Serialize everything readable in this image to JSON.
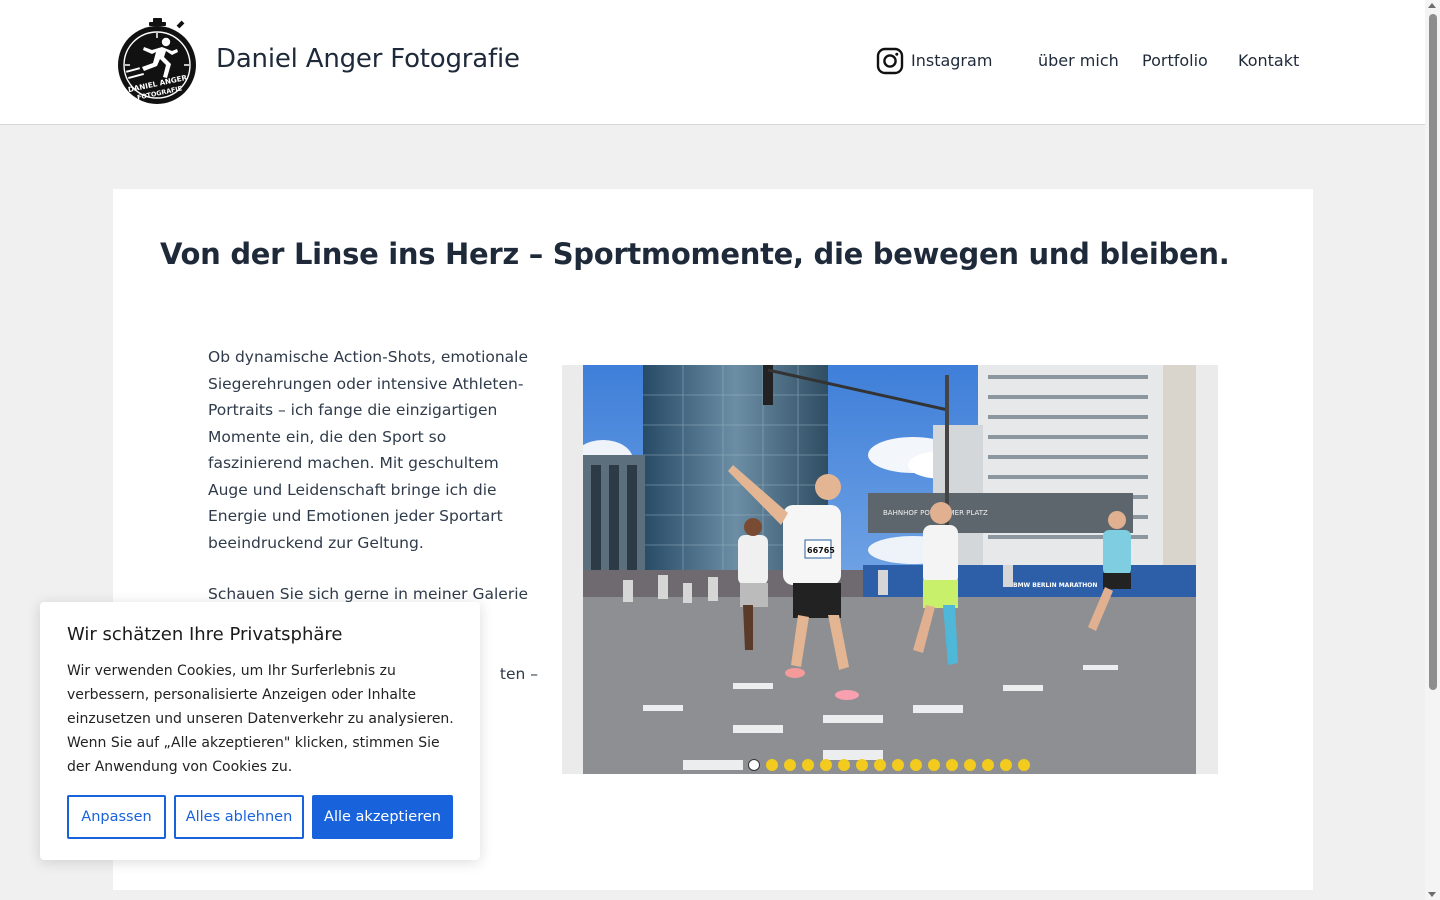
{
  "header": {
    "site_title": "Daniel Anger Fotografie",
    "logo": {
      "line1": "DANIEL ANGER",
      "line2": "FOTOGRAFIE",
      "icon": "stopwatch-runner-logo"
    },
    "nav": {
      "instagram": {
        "label": "Instagram",
        "icon": "instagram-icon"
      },
      "about": "über mich",
      "portfolio": "Portfolio",
      "contact": "Kontakt"
    }
  },
  "main": {
    "headline": "Von der Linse ins Herz – Sportmomente, die bewegen und bleiben.",
    "paragraph1": "Ob dynamische Action-Shots, emotionale Siegerehrungen oder intensive Athleten-Portraits – ich fange die einzigartigen Momente ein, die den Sport so faszinierend machen. Mit geschultem Auge und Leidenschaft bringe ich die Energie und Emotionen jeder Sportart beeindruckend zur Geltung.",
    "paragraph2": "Schauen Sie sich gerne in meiner Galerie um",
    "paragraph3_fragment": "ten –",
    "slider": {
      "image_description": "marathon-runners-potsdamer-platz-photo",
      "slide_count": 16,
      "active_slide": 1,
      "bib_number": "66765",
      "banner_text": "BAHNHOF POTSDAMER PLATZ",
      "race_banner": "BMW BERLIN MARATHON"
    }
  },
  "cookie_banner": {
    "title": "Wir schätzen Ihre Privatsphäre",
    "text": "Wir verwenden Cookies, um Ihr Surferlebnis zu verbessern, personalisierte Anzeigen oder Inhalte einzusetzen und unseren Datenverkehr zu analysieren. Wenn Sie auf „Alle akzeptieren\" klicken, stimmen Sie der Anwendung von Cookies zu.",
    "buttons": {
      "customize": "Anpassen",
      "reject": "Alles ablehnen",
      "accept": "Alle akzeptieren"
    }
  },
  "colors": {
    "text_dark": "#1e2a3a",
    "accent_blue": "#1863dc",
    "slider_dot": "#f2cb1e",
    "page_bg": "#f0f0f0"
  }
}
